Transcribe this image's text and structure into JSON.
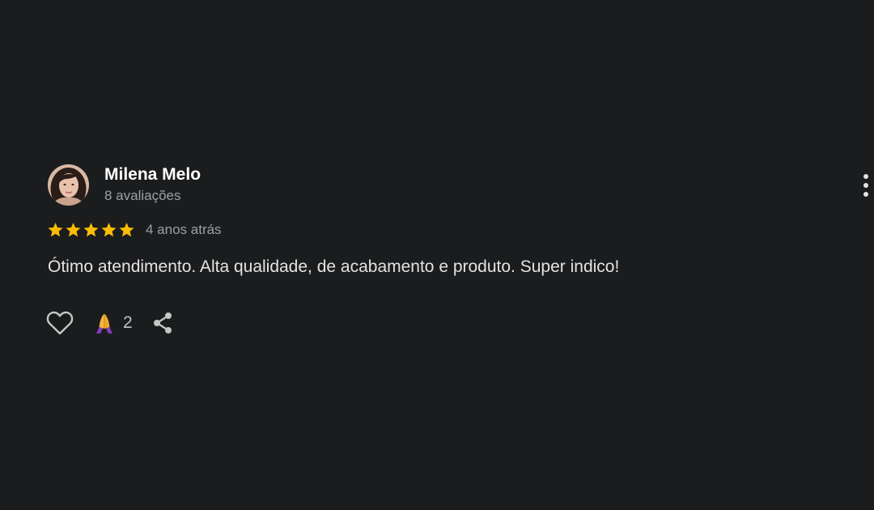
{
  "review": {
    "author": {
      "name": "Milena Melo",
      "meta": "8 avaliações",
      "avatar_icon": "user-photo"
    },
    "rating": 5,
    "rating_max": 5,
    "time": "4 anos atrás",
    "text": "Ótimo atendimento. Alta qualidade, de acabamento e produto. Super indico!",
    "actions": {
      "like_icon": "heart-outline-icon",
      "reaction_icon": "folded-hands-emoji",
      "reaction_count": "2",
      "share_icon": "share-icon",
      "more_icon": "vertical-dots-icon"
    }
  },
  "colors": {
    "background": "#1b1c1e",
    "star": "#fbbc04",
    "name": "#ffffff",
    "secondary_text": "#9aa0a6",
    "body_text": "#e3e3e3"
  }
}
